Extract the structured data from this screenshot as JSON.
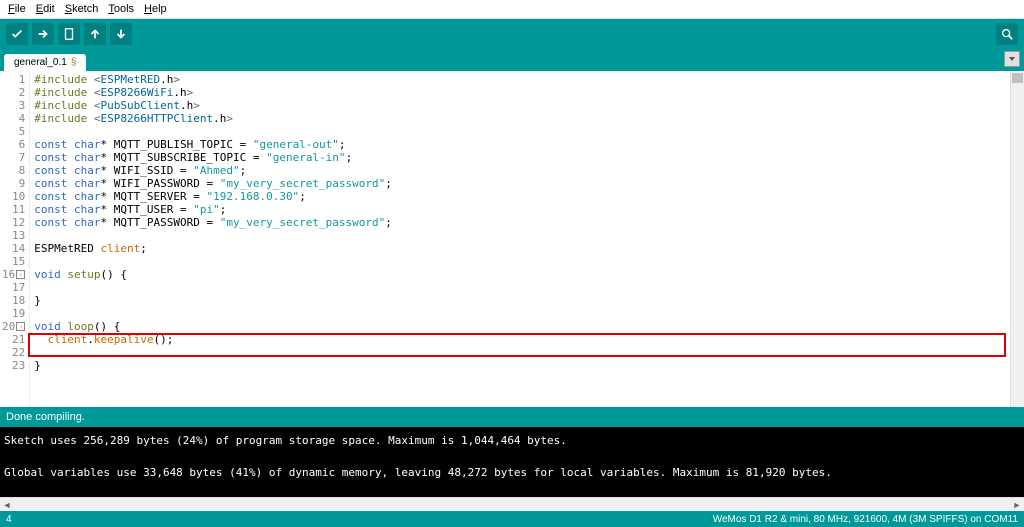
{
  "menu": {
    "file": "File",
    "edit": "Edit",
    "sketch": "Sketch",
    "tools": "Tools",
    "help": "Help"
  },
  "tab": {
    "name": "general_0.1",
    "modified": "§"
  },
  "code": {
    "lines": [
      {
        "n": "1",
        "html": "<span class='kw-pre'>#include</span> <span class='punct'>&lt;</span><span class='inc'>ESPMetRED</span><span class='ln-default'>.h</span><span class='punct'>&gt;</span>"
      },
      {
        "n": "2",
        "html": "<span class='kw-pre'>#include</span> <span class='punct'>&lt;</span><span class='inc'>ESP8266WiFi</span><span class='ln-default'>.h</span><span class='punct'>&gt;</span>"
      },
      {
        "n": "3",
        "html": "<span class='kw-pre'>#include</span> <span class='punct'>&lt;</span><span class='inc'>PubSubClient</span><span class='ln-default'>.h</span><span class='punct'>&gt;</span>"
      },
      {
        "n": "4",
        "html": "<span class='kw-pre'>#include</span> <span class='punct'>&lt;</span><span class='inc'>ESP8266HTTPClient</span><span class='ln-default'>.h</span><span class='punct'>&gt;</span>"
      },
      {
        "n": "5",
        "html": ""
      },
      {
        "n": "6",
        "html": "<span class='kw-blue'>const</span> <span class='kw-blue'>char</span><span class='ln-default'>* MQTT_PUBLISH_TOPIC = </span><span class='str'>\"general-out\"</span><span class='ln-default'>;</span>"
      },
      {
        "n": "7",
        "html": "<span class='kw-blue'>const</span> <span class='kw-blue'>char</span><span class='ln-default'>* MQTT_SUBSCRIBE_TOPIC = </span><span class='str'>\"general-in\"</span><span class='ln-default'>;</span>"
      },
      {
        "n": "8",
        "html": "<span class='kw-blue'>const</span> <span class='kw-blue'>char</span><span class='ln-default'>* WIFI_SSID = </span><span class='str'>\"Ahmed\"</span><span class='ln-default'>;</span>"
      },
      {
        "n": "9",
        "html": "<span class='kw-blue'>const</span> <span class='kw-blue'>char</span><span class='ln-default'>* WIFI_PASSWORD = </span><span class='str'>\"my_very_secret_password\"</span><span class='ln-default'>;</span>"
      },
      {
        "n": "10",
        "html": "<span class='kw-blue'>const</span> <span class='kw-blue'>char</span><span class='ln-default'>* MQTT_SERVER = </span><span class='str'>\"192.168.0.30\"</span><span class='ln-default'>;</span>"
      },
      {
        "n": "11",
        "html": "<span class='kw-blue'>const</span> <span class='kw-blue'>char</span><span class='ln-default'>* MQTT_USER = </span><span class='str'>\"pi\"</span><span class='ln-default'>;</span>"
      },
      {
        "n": "12",
        "html": "<span class='kw-blue'>const</span> <span class='kw-blue'>char</span><span class='ln-default'>* MQTT_PASSWORD = </span><span class='str'>\"my_very_secret_password\"</span><span class='ln-default'>;</span>"
      },
      {
        "n": "13",
        "html": ""
      },
      {
        "n": "14",
        "html": "<span class='ln-default'>ESPMetRED </span><span class='id-orange'>client</span><span class='ln-default'>;</span>"
      },
      {
        "n": "15",
        "html": ""
      },
      {
        "n": "16",
        "fold": true,
        "html": "<span class='kw-blue'>void</span> <span class='kw-pre'>setup</span><span class='ln-default'>() {</span>"
      },
      {
        "n": "17",
        "html": "  "
      },
      {
        "n": "18",
        "html": "<span class='ln-default'>}</span>"
      },
      {
        "n": "19",
        "html": ""
      },
      {
        "n": "20",
        "fold": true,
        "html": "<span class='kw-blue'>void</span> <span class='kw-pre'>loop</span><span class='ln-default'>() {</span>"
      },
      {
        "n": "21",
        "highlight": true,
        "html": "  <span class='id-orange'>client</span><span class='ln-default'>.</span><span class='id-orange'>keepalive</span><span class='ln-default'>();</span>"
      },
      {
        "n": "22",
        "html": "  "
      },
      {
        "n": "23",
        "html": "<span class='ln-default'>}</span>"
      }
    ]
  },
  "status": {
    "compile": "Done compiling."
  },
  "console": {
    "l1": "Sketch uses 256,289 bytes (24%) of program storage space. Maximum is 1,044,464 bytes.",
    "l2": "Global variables use 33,648 bytes (41%) of dynamic memory, leaving 48,272 bytes for local variables. Maximum is 81,920 bytes."
  },
  "footer": {
    "left": "4",
    "right": "WeMos D1 R2 & mini, 80 MHz, 921600, 4M (3M SPIFFS) on COM11"
  }
}
